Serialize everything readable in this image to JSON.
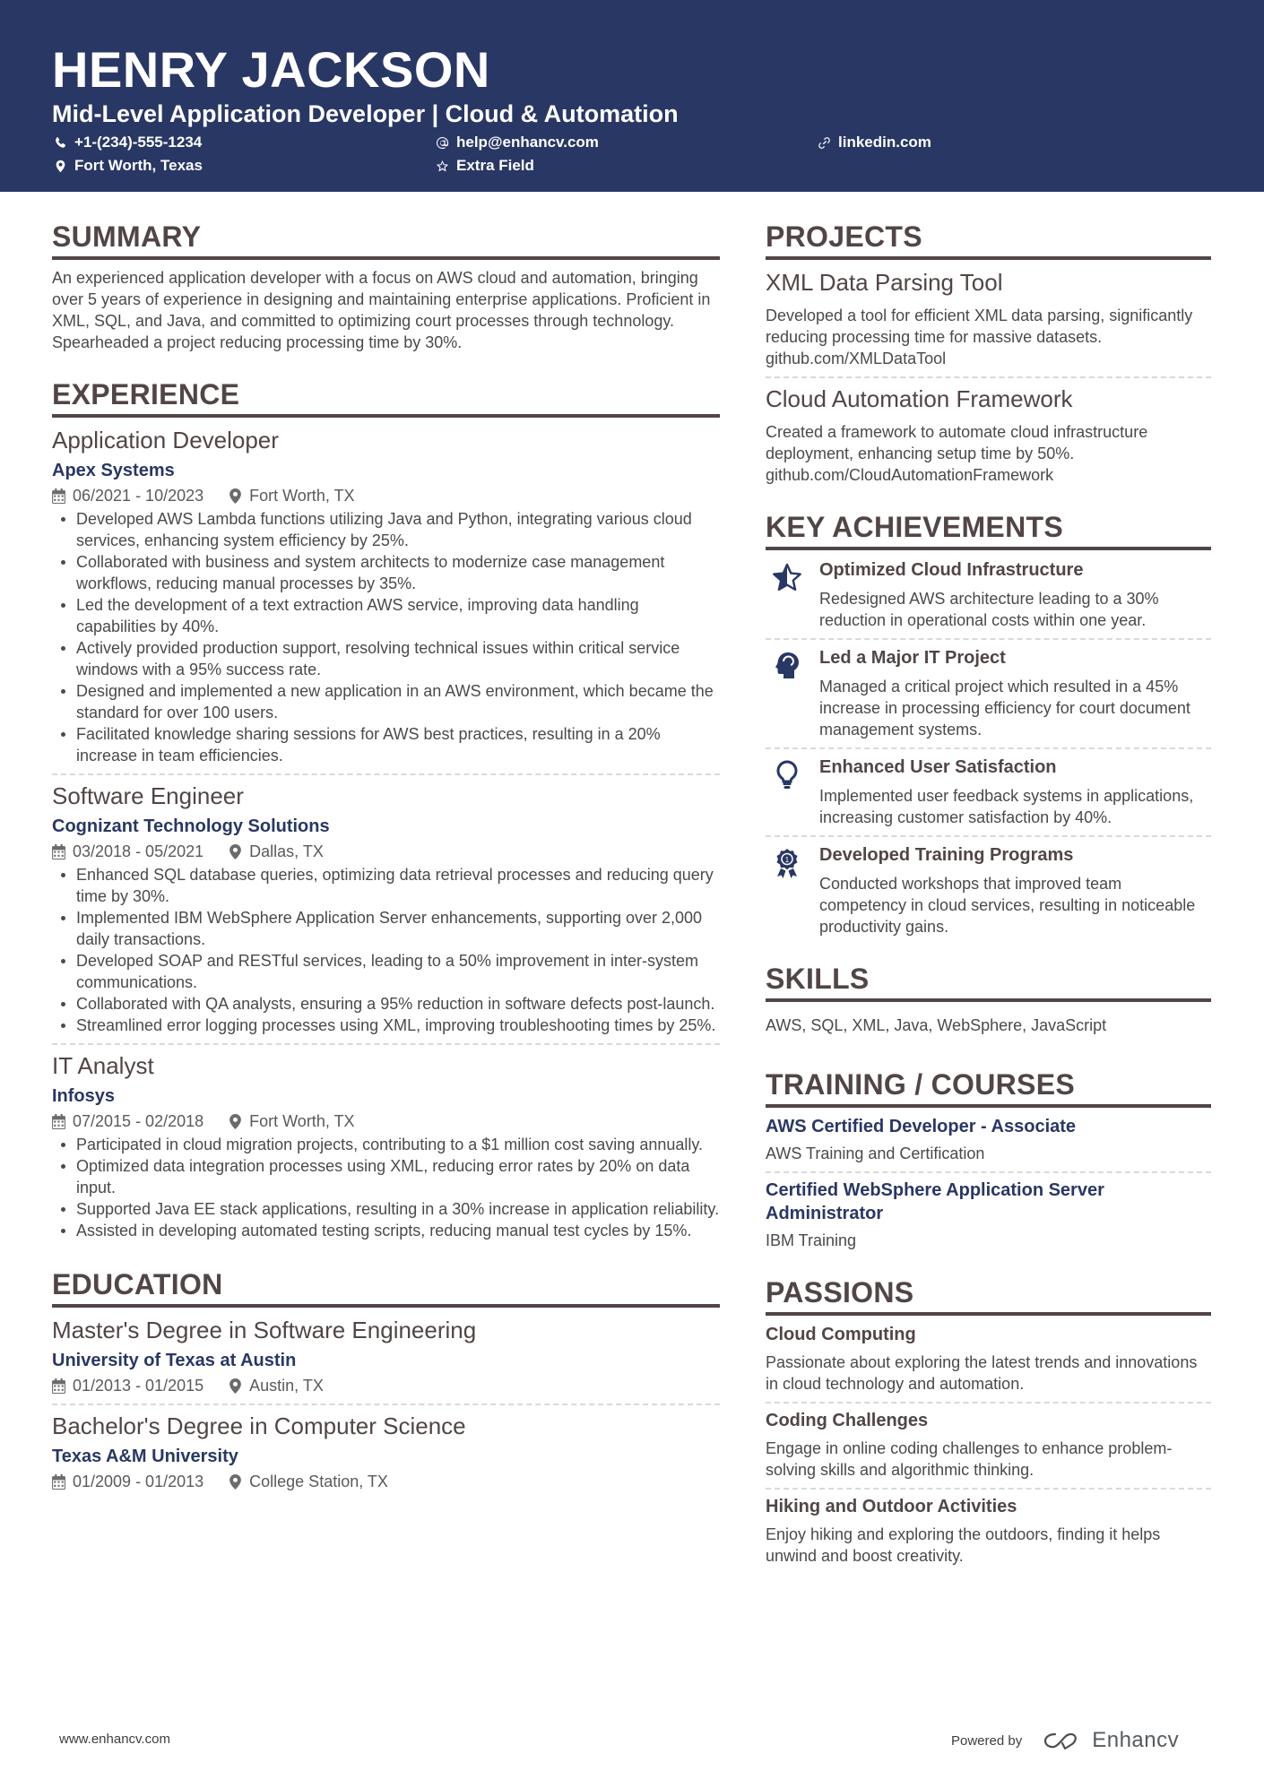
{
  "header": {
    "name": "HENRY JACKSON",
    "title": "Mid-Level Application Developer | Cloud & Automation",
    "contacts": {
      "phone": {
        "icon": "phone-icon",
        "text": "+1-(234)-555-1234"
      },
      "email": {
        "icon": "at-icon",
        "text": "help@enhancv.com"
      },
      "linkedin": {
        "icon": "link-icon",
        "text": "linkedin.com"
      },
      "location": {
        "icon": "location-pin-icon",
        "text": "Fort Worth, Texas"
      },
      "extra": {
        "icon": "star-outline-icon",
        "text": "Extra Field"
      }
    }
  },
  "summary": {
    "heading": "SUMMARY",
    "text": "An experienced application developer with a focus on AWS cloud and automation, bringing over 5 years of experience in designing and maintaining enterprise applications. Proficient in XML, SQL, and Java, and committed to optimizing court processes through technology. Spearheaded a project reducing processing time by 30%."
  },
  "experience": {
    "heading": "EXPERIENCE",
    "jobs": [
      {
        "role": "Application Developer",
        "company": "Apex Systems",
        "dates": "06/2021 - 10/2023",
        "location": "Fort Worth, TX",
        "bullets": [
          "Developed AWS Lambda functions utilizing Java and Python, integrating various cloud services, enhancing system efficiency by 25%.",
          "Collaborated with business and system architects to modernize case management workflows, reducing manual processes by 35%.",
          "Led the development of a text extraction AWS service, improving data handling capabilities by 40%.",
          "Actively provided production support, resolving technical issues within critical service windows with a 95% success rate.",
          "Designed and implemented a new application in an AWS environment, which became the standard for over 100 users.",
          "Facilitated knowledge sharing sessions for AWS best practices, resulting in a 20% increase in team efficiencies."
        ]
      },
      {
        "role": "Software Engineer",
        "company": "Cognizant Technology Solutions",
        "dates": "03/2018 - 05/2021",
        "location": "Dallas, TX",
        "bullets": [
          "Enhanced SQL database queries, optimizing data retrieval processes and reducing query time by 30%.",
          "Implemented IBM WebSphere Application Server enhancements, supporting over 2,000 daily transactions.",
          "Developed SOAP and RESTful services, leading to a 50% improvement in inter-system communications.",
          "Collaborated with QA analysts, ensuring a 95% reduction in software defects post-launch.",
          "Streamlined error logging processes using XML, improving troubleshooting times by 25%."
        ]
      },
      {
        "role": "IT Analyst",
        "company": "Infosys",
        "dates": "07/2015 - 02/2018",
        "location": "Fort Worth, TX",
        "bullets": [
          "Participated in cloud migration projects, contributing to a $1 million cost saving annually.",
          "Optimized data integration processes using XML, reducing error rates by 20% on data input.",
          "Supported Java EE stack applications, resulting in a 30% increase in application reliability.",
          "Assisted in developing automated testing scripts, reducing manual test cycles by 15%."
        ]
      }
    ]
  },
  "education": {
    "heading": "EDUCATION",
    "items": [
      {
        "degree": "Master's Degree in Software Engineering",
        "school": "University of Texas at Austin",
        "dates": "01/2013 - 01/2015",
        "location": "Austin, TX"
      },
      {
        "degree": "Bachelor's Degree in Computer Science",
        "school": "Texas A&M University",
        "dates": "01/2009 - 01/2013",
        "location": "College Station, TX"
      }
    ]
  },
  "projects": {
    "heading": "PROJECTS",
    "items": [
      {
        "title": "XML Data Parsing Tool",
        "description": "Developed a tool for efficient XML data parsing, significantly reducing processing time for massive datasets. github.com/XMLDataTool"
      },
      {
        "title": "Cloud Automation Framework",
        "description": "Created a framework to automate cloud infrastructure deployment, enhancing setup time by 50%. github.com/CloudAutomationFramework"
      }
    ]
  },
  "achievements": {
    "heading": "KEY ACHIEVEMENTS",
    "items": [
      {
        "icon": "star-half-icon",
        "title": "Optimized Cloud Infrastructure",
        "description": "Redesigned AWS architecture leading to a 30% reduction in operational costs within one year."
      },
      {
        "icon": "head-brain-icon",
        "title": "Led a Major IT Project",
        "description": "Managed a critical project which resulted in a 45% increase in processing efficiency for court document management systems."
      },
      {
        "icon": "lightbulb-icon",
        "title": "Enhanced User Satisfaction",
        "description": "Implemented user feedback systems in applications, increasing customer satisfaction by 40%."
      },
      {
        "icon": "award-ribbon-icon",
        "title": "Developed Training Programs",
        "description": "Conducted workshops that improved team competency in cloud services, resulting in noticeable productivity gains."
      }
    ]
  },
  "skills": {
    "heading": "SKILLS",
    "text": "AWS, SQL, XML, Java, WebSphere, JavaScript"
  },
  "training": {
    "heading": "TRAINING / COURSES",
    "items": [
      {
        "title": "AWS Certified Developer - Associate",
        "org": "AWS Training and Certification"
      },
      {
        "title": "Certified WebSphere Application Server Administrator",
        "org": "IBM Training"
      }
    ]
  },
  "passions": {
    "heading": "PASSIONS",
    "items": [
      {
        "title": "Cloud Computing",
        "description": "Passionate about exploring the latest trends and innovations in cloud technology and automation."
      },
      {
        "title": "Coding Challenges",
        "description": "Engage in online coding challenges to enhance problem-solving skills and algorithmic thinking."
      },
      {
        "title": "Hiking and Outdoor Activities",
        "description": "Enjoy hiking and exploring the outdoors, finding it helps unwind and boost creativity."
      }
    ]
  },
  "footer": {
    "website": "www.enhancv.com",
    "powered_by": "Powered by",
    "brand": "Enhancv"
  },
  "colors": {
    "header_bg": "#293765",
    "accent": "#293765",
    "heading": "#524545",
    "text": "#4a4a4a"
  }
}
